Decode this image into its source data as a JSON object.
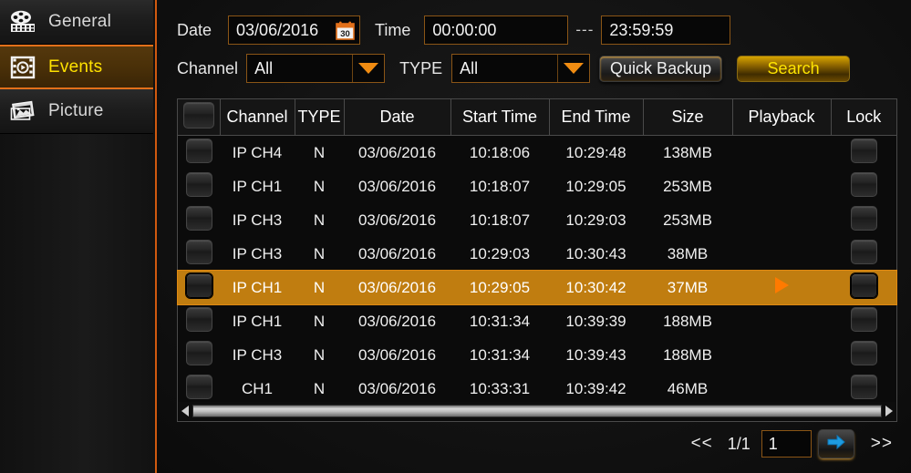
{
  "sidebar": {
    "items": [
      {
        "label": "General",
        "icon": "film-reel-icon",
        "active": false
      },
      {
        "label": "Events",
        "icon": "event-clip-icon",
        "active": true
      },
      {
        "label": "Picture",
        "icon": "photos-icon",
        "active": false
      }
    ]
  },
  "search_form": {
    "date_label": "Date",
    "date_value": "03/06/2016",
    "date_icon": "calendar-icon",
    "time_label": "Time",
    "time_start": "00:00:00",
    "time_separator": "---",
    "time_end": "23:59:59",
    "channel_label": "Channel",
    "channel_value": "All",
    "type_label": "TYPE",
    "type_value": "All",
    "quick_backup_label": "Quick Backup",
    "search_label": "Search"
  },
  "table": {
    "columns": [
      "",
      "Channel",
      "TYPE",
      "Date",
      "Start Time",
      "End Time",
      "Size",
      "Playback",
      "Lock"
    ],
    "rows": [
      {
        "channel": "IP CH4",
        "type": "N",
        "date": "03/06/2016",
        "start": "10:18:06",
        "end": "10:29:48",
        "size": "138MB",
        "playback": false,
        "selected": false
      },
      {
        "channel": "IP CH1",
        "type": "N",
        "date": "03/06/2016",
        "start": "10:18:07",
        "end": "10:29:05",
        "size": "253MB",
        "playback": false,
        "selected": false
      },
      {
        "channel": "IP CH3",
        "type": "N",
        "date": "03/06/2016",
        "start": "10:18:07",
        "end": "10:29:03",
        "size": "253MB",
        "playback": false,
        "selected": false
      },
      {
        "channel": "IP CH3",
        "type": "N",
        "date": "03/06/2016",
        "start": "10:29:03",
        "end": "10:30:43",
        "size": "38MB",
        "playback": false,
        "selected": false
      },
      {
        "channel": "IP CH1",
        "type": "N",
        "date": "03/06/2016",
        "start": "10:29:05",
        "end": "10:30:42",
        "size": "37MB",
        "playback": true,
        "selected": true
      },
      {
        "channel": "IP CH1",
        "type": "N",
        "date": "03/06/2016",
        "start": "10:31:34",
        "end": "10:39:39",
        "size": "188MB",
        "playback": false,
        "selected": false
      },
      {
        "channel": "IP CH3",
        "type": "N",
        "date": "03/06/2016",
        "start": "10:31:34",
        "end": "10:39:43",
        "size": "188MB",
        "playback": false,
        "selected": false
      },
      {
        "channel": "CH1",
        "type": "N",
        "date": "03/06/2016",
        "start": "10:33:31",
        "end": "10:39:42",
        "size": "46MB",
        "playback": false,
        "selected": false
      }
    ]
  },
  "pager": {
    "prev_label": "<<",
    "page_count": "1/1",
    "page_input": "1",
    "go_icon": "arrow-right-icon",
    "next_label": ">>"
  },
  "colors": {
    "accent_orange": "#d0590f",
    "highlight_row": "#c07d10",
    "active_nav_text": "#ffe200",
    "search_text": "#ffe500",
    "caret": "#f08c12",
    "play_triangle": "#ff7a00",
    "go_arrow": "#1e9be0"
  }
}
